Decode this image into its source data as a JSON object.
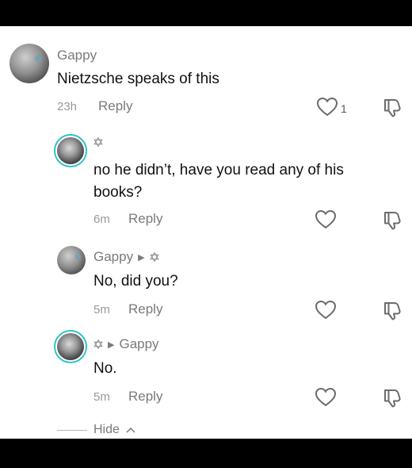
{
  "comments": [
    {
      "author": "Gappy",
      "text": "Nietzsche speaks of this",
      "time": "23h",
      "reply_label": "Reply",
      "like_count": "1"
    },
    {
      "author": "",
      "text_line1": "no he didn’t, have you read any of his",
      "text_line2": "books?",
      "time": "6m",
      "reply_label": "Reply"
    },
    {
      "author": "Gappy",
      "text": "No, did you?",
      "time": "5m",
      "reply_label": "Reply"
    },
    {
      "reply_to": "Gappy",
      "text": "No.",
      "time": "5m",
      "reply_label": "Reply"
    }
  ],
  "footer": {
    "hide_label": "Hide"
  },
  "colors": {
    "ring": "#2ec4c9",
    "muted": "#7a7a7a",
    "text": "#111111"
  },
  "icons": [
    "heart-icon",
    "dislike-icon",
    "star-of-david-icon",
    "play-triangle-icon",
    "chevron-up-icon"
  ]
}
